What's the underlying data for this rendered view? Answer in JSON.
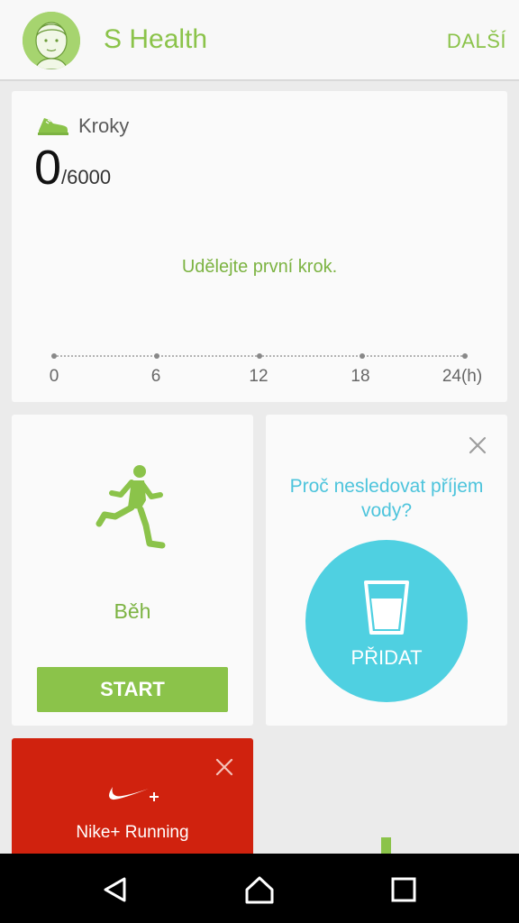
{
  "appbar": {
    "title": "S Health",
    "more_label": "DALŠÍ",
    "avatar_icon": "avatar-face-icon"
  },
  "steps": {
    "label": "Kroky",
    "count": "0",
    "goal": "/6000",
    "message": "Udělejte první krok.",
    "ticks": [
      "0",
      "6",
      "12",
      "18",
      "24(h)"
    ],
    "icon": "shoe-icon"
  },
  "run": {
    "label": "Běh",
    "start_label": "START",
    "icon": "runner-icon"
  },
  "water": {
    "prompt": "Proč nesledovat příjem vody?",
    "add_label": "PŘIDAT",
    "icon": "glass-icon"
  },
  "nike": {
    "label": "Nike+ Running",
    "icon": "nike-swoosh-icon"
  },
  "colors": {
    "accent_green": "#8bc34a",
    "water_cyan": "#4fd0e1",
    "nike_red": "#d0220e"
  }
}
